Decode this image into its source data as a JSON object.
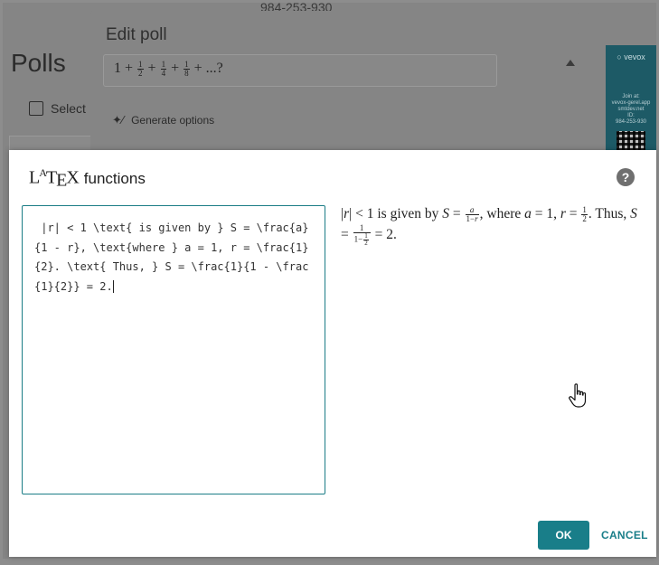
{
  "background": {
    "phone_id": "984-253-930",
    "page_title": "Polls",
    "select_label": "Select",
    "side_panel": {
      "logo": "vevox",
      "join_text": "Join at:",
      "join_url": "vevox-gerel.app\nsmtdev.net",
      "id_label": "ID:",
      "id_value": "984-253-930"
    }
  },
  "edit_poll": {
    "title": "Edit poll",
    "question_preview": "1 + 1/2 + 1/4 + 1/8 + ...?",
    "generate_options_label": "Generate options"
  },
  "latex_modal": {
    "title_logo": "LaTeX",
    "title_text": "functions",
    "help_icon": "?",
    "editor_value": " |r| < 1 \\text{ is given by } S = \\frac{a}{1 - r}, \\text{where } a = 1, r = \\frac{1}{2}. \\text{ Thus, } S = \\frac{1}{1 - \\frac{1}{2}} = 2.",
    "ok_label": "OK",
    "cancel_label": "CANCEL"
  },
  "colors": {
    "accent": "#197e89",
    "side_panel": "#1d5a66"
  }
}
